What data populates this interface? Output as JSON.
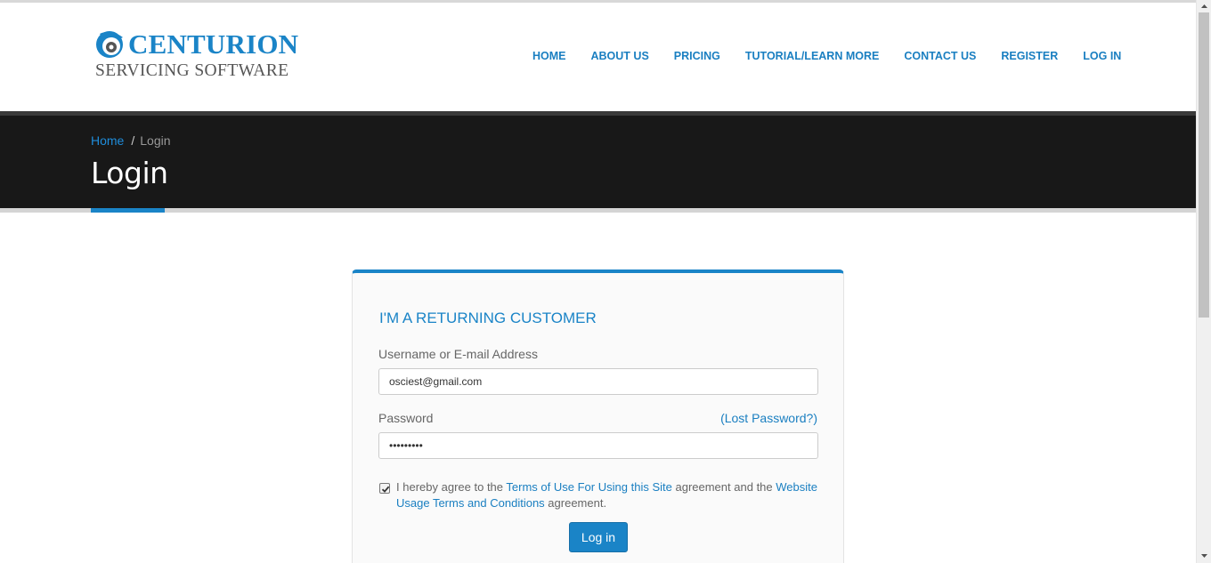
{
  "logo": {
    "line1": "CENTURION",
    "line2": "SERVICING SOFTWARE"
  },
  "nav": [
    {
      "label": "HOME"
    },
    {
      "label": "ABOUT US"
    },
    {
      "label": "PRICING"
    },
    {
      "label": "TUTORIAL/LEARN MORE"
    },
    {
      "label": "CONTACT US"
    },
    {
      "label": "REGISTER"
    },
    {
      "label": "LOG IN"
    }
  ],
  "breadcrumb": {
    "home": "Home",
    "separator": "/",
    "current": "Login"
  },
  "page_title": "Login",
  "login_form": {
    "heading": "I'M A RETURNING CUSTOMER",
    "username_label": "Username or E-mail Address",
    "username_value": "osciest@gmail.com",
    "password_label": "Password",
    "password_value": "•••••••••",
    "lost_password": "(Lost Password?)",
    "agree_checked": true,
    "agree_text_1": "I hereby agree to the ",
    "terms_link": "Terms of Use For Using this Site",
    "agree_text_2": " agreement and the ",
    "usage_link": "Website Usage Terms and Conditions",
    "agree_text_3": " agreement.",
    "submit_label": "Log in"
  },
  "colors": {
    "brand_blue": "#1a84c7",
    "title_band": "#181818"
  }
}
